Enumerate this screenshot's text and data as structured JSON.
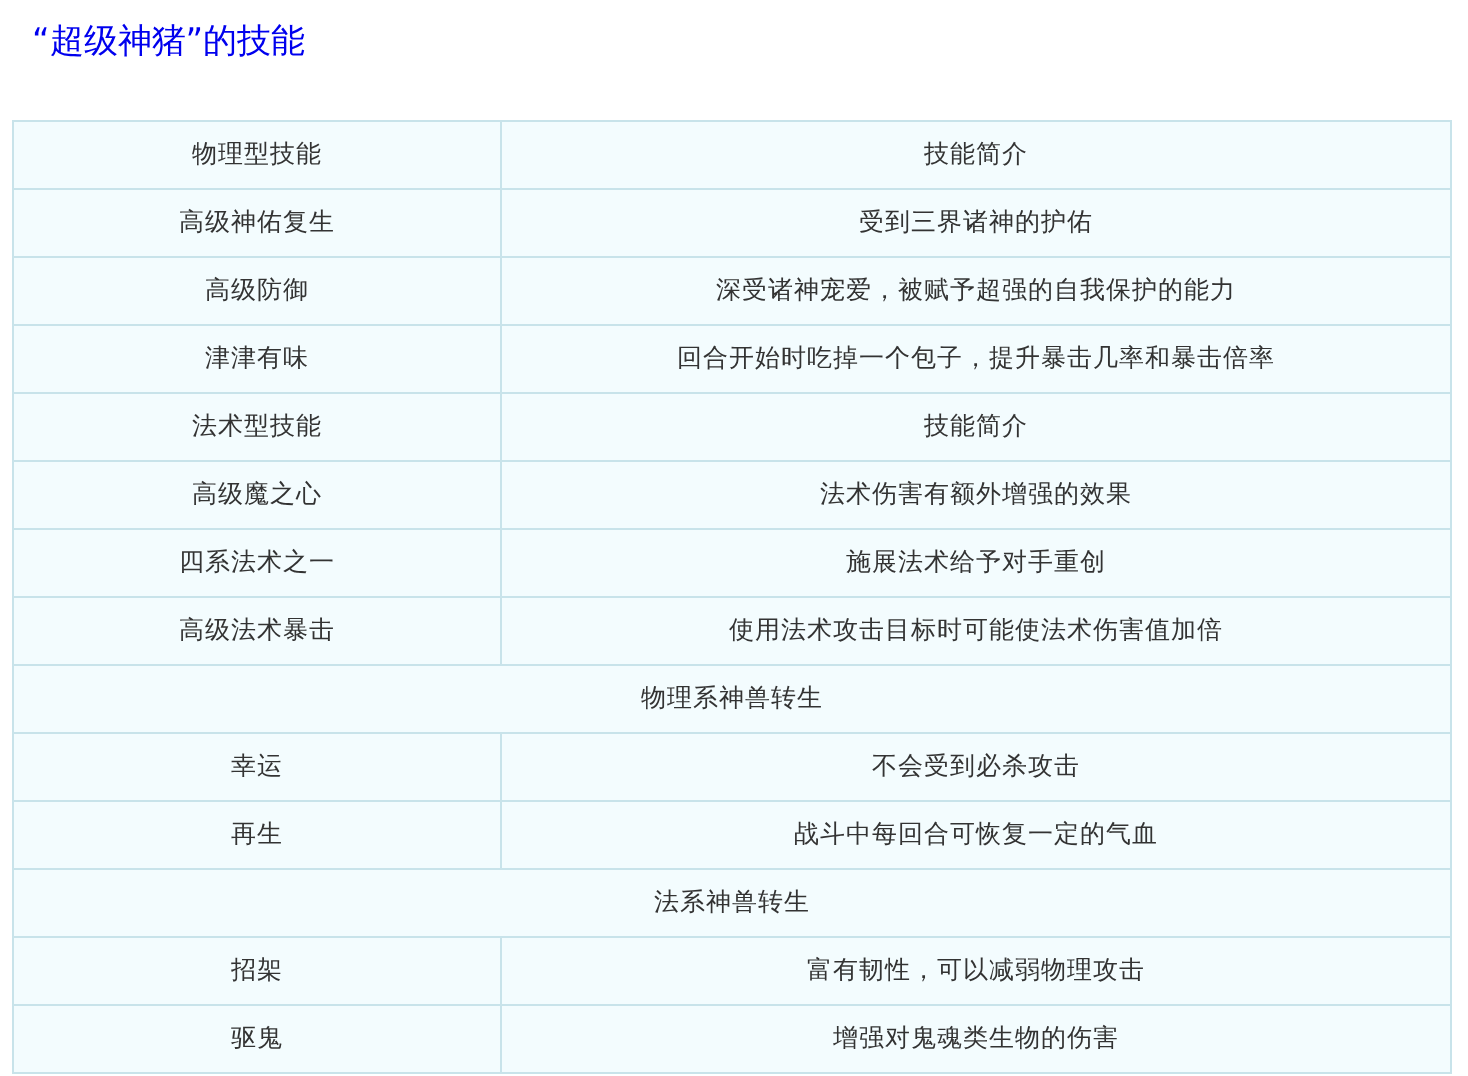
{
  "title": "“超级神猪”的技能",
  "rows": [
    {
      "kind": "pair",
      "cells": [
        "物理型技能",
        "技能简介"
      ]
    },
    {
      "kind": "pair",
      "cells": [
        "高级神佑复生",
        "受到三界诸神的护佑"
      ]
    },
    {
      "kind": "pair",
      "cells": [
        "高级防御",
        "深受诸神宠爱，被赋予超强的自我保护的能力"
      ]
    },
    {
      "kind": "pair",
      "cells": [
        "津津有味",
        "回合开始时吃掉一个包子，提升暴击几率和暴击倍率"
      ]
    },
    {
      "kind": "pair",
      "cells": [
        "法术型技能",
        "技能简介"
      ]
    },
    {
      "kind": "pair",
      "cells": [
        "高级魔之心",
        "法术伤害有额外增强的效果"
      ]
    },
    {
      "kind": "pair",
      "cells": [
        "四系法术之一",
        "施展法术给予对手重创"
      ]
    },
    {
      "kind": "pair",
      "cells": [
        "高级法术暴击",
        "使用法术攻击目标时可能使法术伤害值加倍"
      ]
    },
    {
      "kind": "span",
      "cells": [
        "物理系神兽转生"
      ]
    },
    {
      "kind": "pair",
      "cells": [
        "幸运",
        "不会受到必杀攻击"
      ]
    },
    {
      "kind": "pair",
      "cells": [
        "再生",
        "战斗中每回合可恢复一定的气血"
      ]
    },
    {
      "kind": "span",
      "cells": [
        "法系神兽转生"
      ]
    },
    {
      "kind": "pair",
      "cells": [
        "招架",
        "富有韧性，可以减弱物理攻击"
      ]
    },
    {
      "kind": "pair",
      "cells": [
        "驱鬼",
        "增强对鬼魂类生物的伤害"
      ]
    }
  ]
}
